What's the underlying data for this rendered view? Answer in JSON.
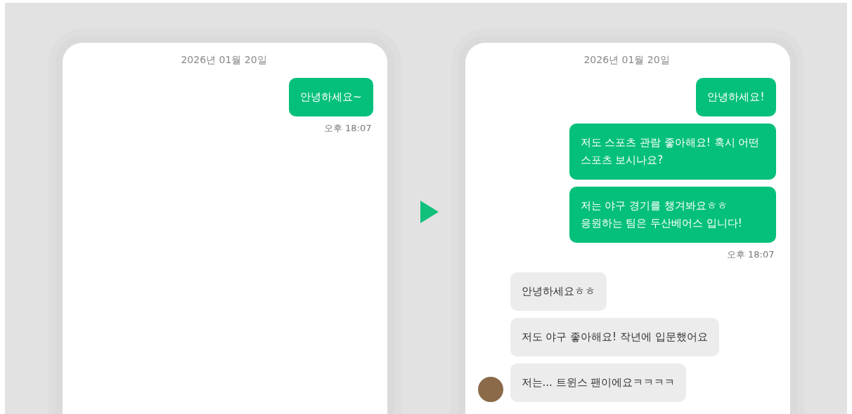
{
  "phones": [
    {
      "date": "2026년 01월 20일",
      "messages": [
        {
          "kind": "sent",
          "text": "안녕하세요~"
        },
        {
          "kind": "time",
          "text": "오후 18:07"
        }
      ]
    },
    {
      "date": "2026년 01월 20일",
      "messages": [
        {
          "kind": "sent",
          "text": "안녕하세요!"
        },
        {
          "kind": "sent",
          "text": "저도 스포츠 관람 좋아해요! 혹시 어떤 스포츠 보시나요?"
        },
        {
          "kind": "sent",
          "text": "저는 야구 경기를 챙겨봐요ㅎㅎ 응원하는 팀은 두산베어스 입니다!"
        },
        {
          "kind": "time",
          "text": "오후 18:07"
        },
        {
          "kind": "received",
          "text": "안녕하세요ㅎㅎ",
          "avatar": false
        },
        {
          "kind": "received",
          "text": "저도 야구 좋아해요! 작년에 입문했어요",
          "avatar": false
        },
        {
          "kind": "received",
          "text": "저는... 트윈스 팬이에요ㅋㅋㅋㅋ",
          "avatar": true
        }
      ]
    }
  ]
}
